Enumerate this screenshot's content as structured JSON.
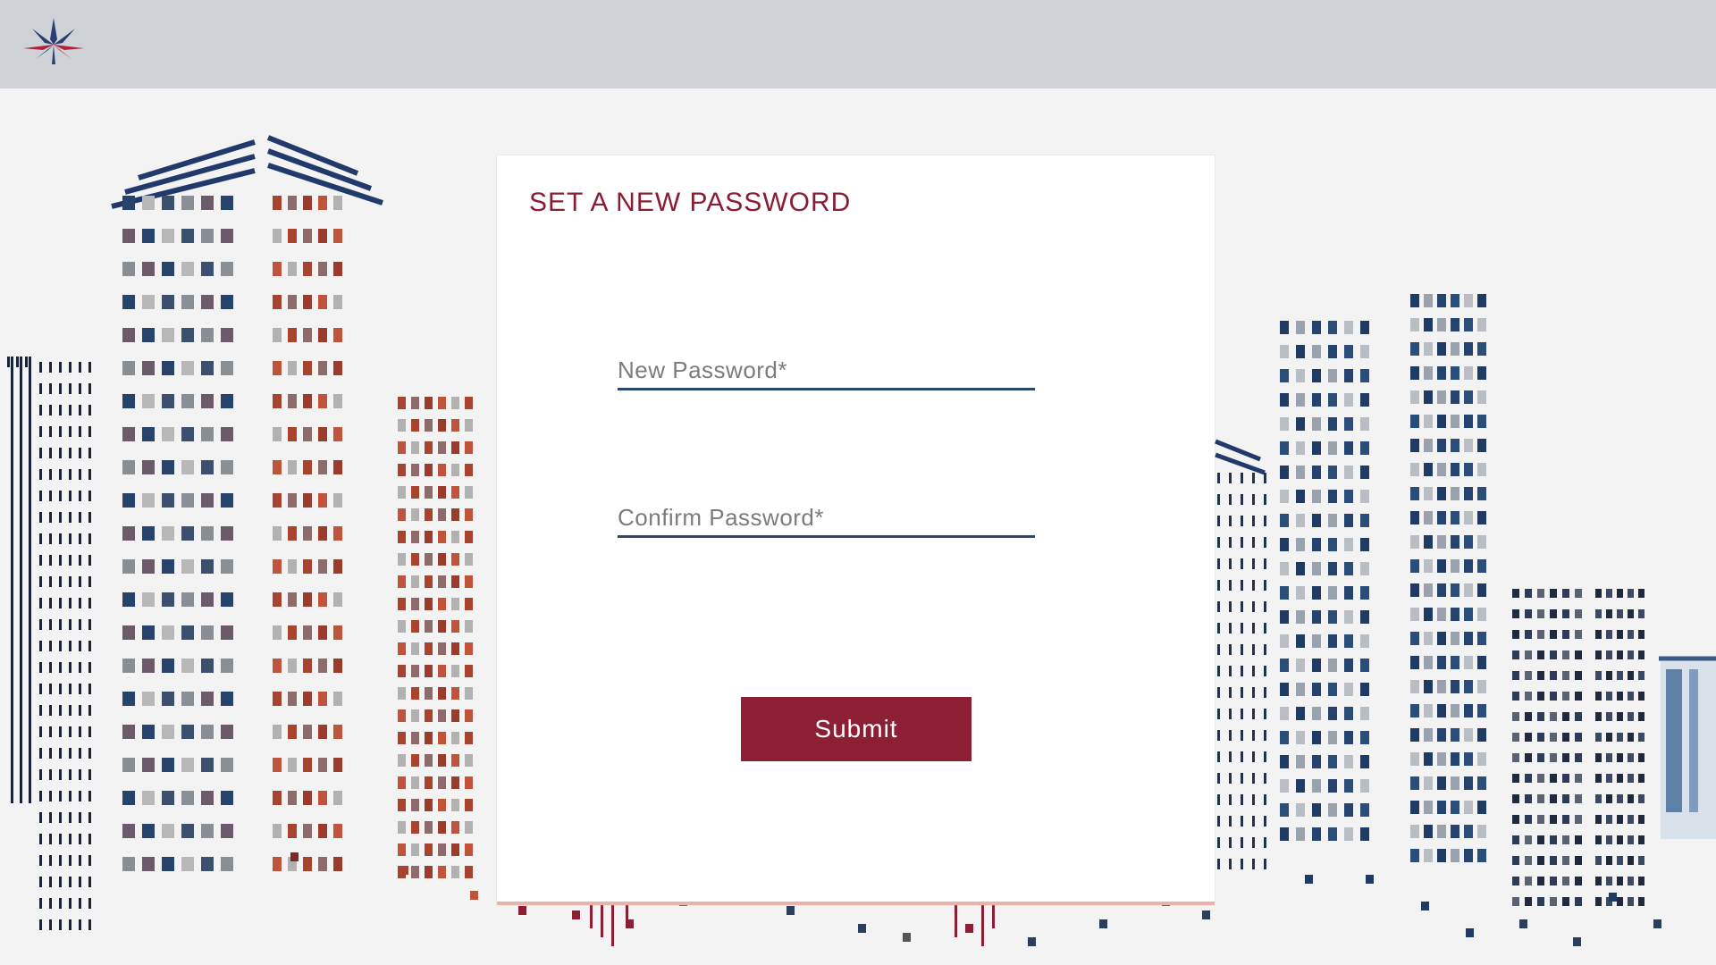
{
  "app": {
    "logo_icon": "leaf-star-logo",
    "brand_colors": {
      "primary": "#8d1f35",
      "navy": "#2b4a6b",
      "header_bg": "#cfd2d6"
    }
  },
  "form": {
    "title": "SET A NEW PASSWORD",
    "new_password": {
      "placeholder": "New Password*",
      "value": ""
    },
    "confirm_password": {
      "placeholder": "Confirm Password*",
      "value": ""
    },
    "submit_label": "Submit"
  },
  "background": {
    "illustration": "city-skyline-illustration"
  }
}
